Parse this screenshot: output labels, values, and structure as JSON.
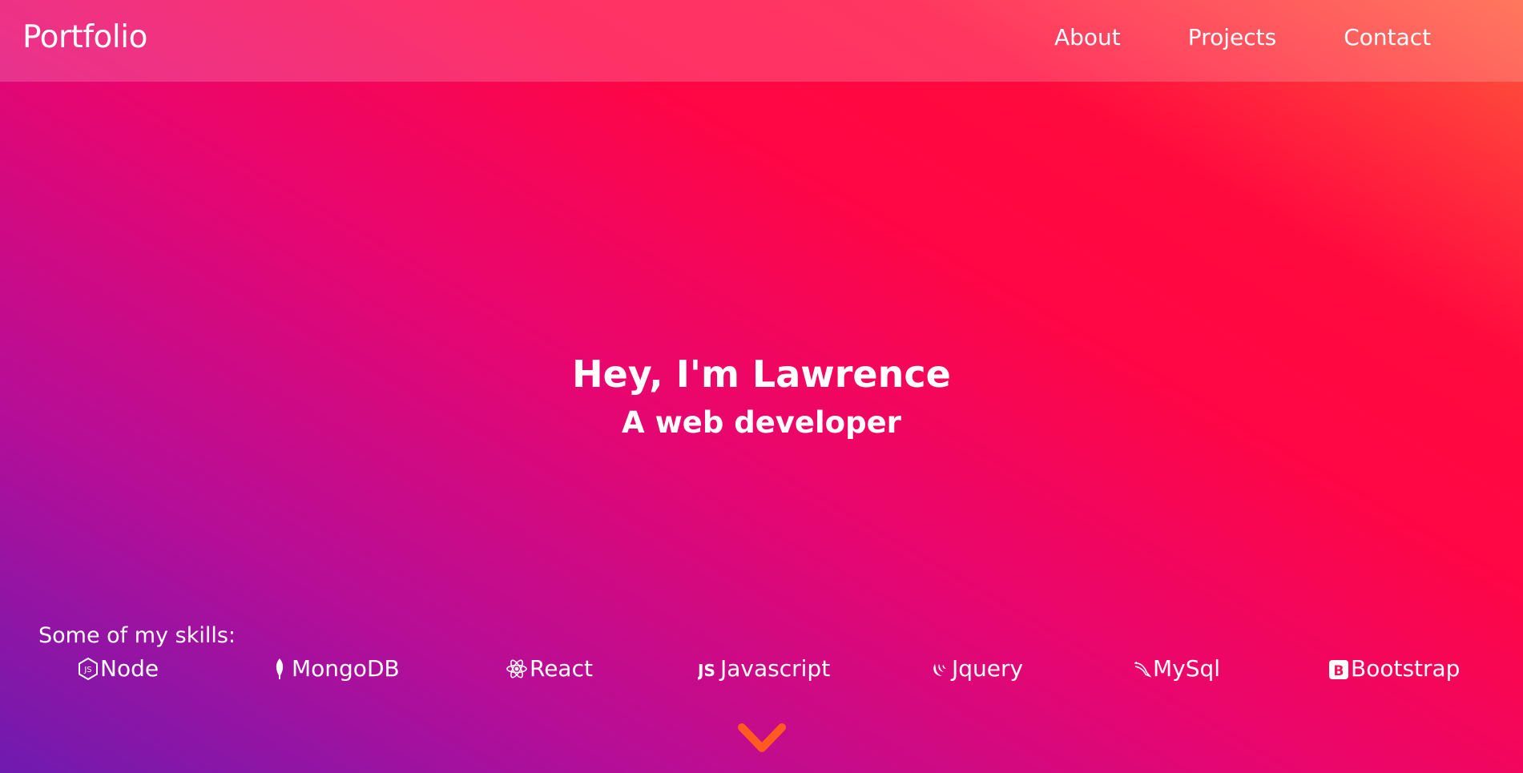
{
  "navbar": {
    "brand": "Portfolio",
    "links": [
      "About",
      "Projects",
      "Contact"
    ]
  },
  "hero": {
    "title": "Hey, I'm Lawrence",
    "subtitle": "A web developer"
  },
  "skills": {
    "label": "Some of my skills:",
    "items": [
      {
        "name": "Node",
        "icon": "nodejs-icon"
      },
      {
        "name": "MongoDB",
        "icon": "mongodb-leaf-icon"
      },
      {
        "name": "React",
        "icon": "react-atom-icon"
      },
      {
        "name": "Javascript",
        "icon": "js-icon"
      },
      {
        "name": "Jquery",
        "icon": "jquery-icon"
      },
      {
        "name": "MySql",
        "icon": "mysql-dolphin-icon"
      },
      {
        "name": "Bootstrap",
        "icon": "bootstrap-icon"
      }
    ]
  },
  "scroll": {
    "icon": "chevron-down-icon",
    "color": "#ff5a1f"
  },
  "colors": {
    "gradient_start": "#6f1bb0",
    "gradient_mid": "#ff0645",
    "gradient_end": "#ff5a3a",
    "text": "#ffffff"
  }
}
